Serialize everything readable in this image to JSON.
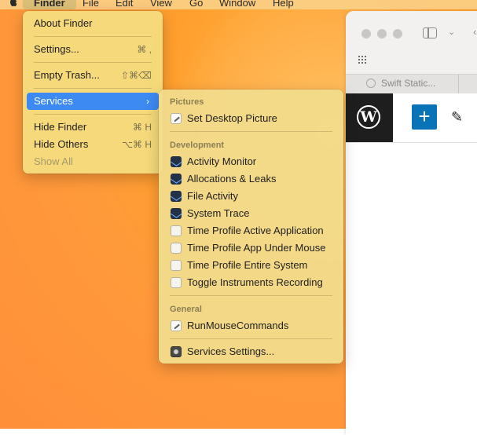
{
  "menubar": {
    "items": [
      "Finder",
      "File",
      "Edit",
      "View",
      "Go",
      "Window",
      "Help"
    ]
  },
  "finder_menu": {
    "items": [
      {
        "label": "About Finder",
        "shortcut": ""
      },
      {
        "label": "Settings...",
        "shortcut": "⌘ ,"
      },
      {
        "label": "Empty Trash...",
        "shortcut": "⇧⌘⌫"
      },
      {
        "label": "Services",
        "shortcut": "›"
      },
      {
        "label": "Hide Finder",
        "shortcut": "⌘ H"
      },
      {
        "label": "Hide Others",
        "shortcut": "⌥⌘ H"
      },
      {
        "label": "Show All",
        "shortcut": ""
      }
    ]
  },
  "services_menu": {
    "sections": [
      "Pictures",
      "Development",
      "General"
    ],
    "pictures": [
      "Set Desktop Picture"
    ],
    "development": [
      "Activity Monitor",
      "Allocations & Leaks",
      "File Activity",
      "System Trace",
      "Time Profile Active Application",
      "Time Profile App Under Mouse",
      "Time Profile Entire System",
      "Toggle Instruments Recording"
    ],
    "general": [
      "RunMouseCommands"
    ],
    "settings": "Services Settings..."
  },
  "browser": {
    "tab_title": "Swift Static...",
    "wp_logo_letter": "W",
    "add_label": "+",
    "edit_glyph": "✎"
  },
  "colors": {
    "selection": "#3c8af2",
    "menu_bg": "#f4de80",
    "desktop": "#ff9f2e",
    "wp_blue": "#0a73b7"
  }
}
